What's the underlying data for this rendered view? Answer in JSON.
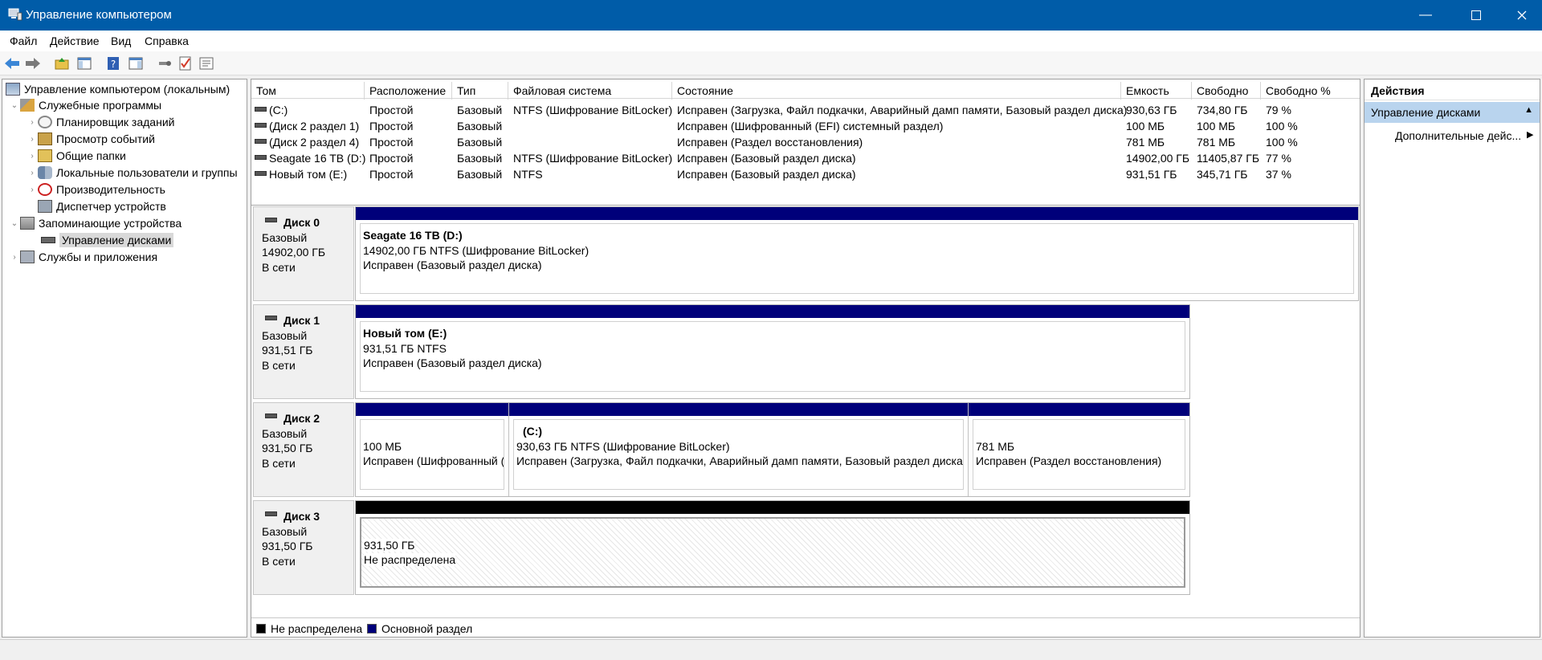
{
  "window": {
    "title": "Управление компьютером"
  },
  "menu": [
    "Файл",
    "Действие",
    "Вид",
    "Справка"
  ],
  "tree": {
    "root": "Управление компьютером (локальным)",
    "utilities": "Служебные программы",
    "scheduler": "Планировщик заданий",
    "events": "Просмотр событий",
    "shared": "Общие папки",
    "users": "Локальные пользователи и группы",
    "perf": "Производительность",
    "devmgr": "Диспетчер устройств",
    "storage": "Запоминающие устройства",
    "diskmgmt": "Управление дисками",
    "services": "Службы и приложения"
  },
  "volumes": {
    "headers": [
      "Том",
      "Расположение",
      "Тип",
      "Файловая система",
      "Состояние",
      "Емкость",
      "Свободно",
      "Свободно %"
    ],
    "rows": [
      [
        "(C:)",
        "Простой",
        "Базовый",
        "NTFS (Шифрование BitLocker)",
        "Исправен (Загрузка, Файл подкачки, Аварийный дамп памяти, Базовый раздел диска)",
        "930,63 ГБ",
        "734,80 ГБ",
        "79 %"
      ],
      [
        "(Диск 2 раздел 1)",
        "Простой",
        "Базовый",
        "",
        "Исправен (Шифрованный (EFI) системный раздел)",
        "100 МБ",
        "100 МБ",
        "100 %"
      ],
      [
        "(Диск 2 раздел 4)",
        "Простой",
        "Базовый",
        "",
        "Исправен (Раздел восстановления)",
        "781 МБ",
        "781 МБ",
        "100 %"
      ],
      [
        "Seagate 16 TB (D:)",
        "Простой",
        "Базовый",
        "NTFS (Шифрование BitLocker)",
        "Исправен (Базовый раздел диска)",
        "14902,00 ГБ",
        "11405,87 ГБ",
        "77 %"
      ],
      [
        "Новый том (E:)",
        "Простой",
        "Базовый",
        "NTFS",
        "Исправен (Базовый раздел диска)",
        "931,51 ГБ",
        "345,71 ГБ",
        "37 %"
      ]
    ]
  },
  "disks": [
    {
      "name": "Диск 0",
      "type": "Базовый",
      "size": "14902,00 ГБ",
      "state": "В сети",
      "parts": [
        {
          "title": "Seagate 16 TB  (D:)",
          "l1": "14902,00 ГБ NTFS (Шифрование BitLocker)",
          "l2": "Исправен (Базовый раздел диска)"
        }
      ]
    },
    {
      "name": "Диск 1",
      "type": "Базовый",
      "size": "931,51 ГБ",
      "state": "В сети",
      "parts": [
        {
          "title": "Новый том  (E:)",
          "l1": "931,51 ГБ NTFS",
          "l2": "Исправен (Базовый раздел диска)"
        }
      ]
    },
    {
      "name": "Диск 2",
      "type": "Базовый",
      "size": "931,50 ГБ",
      "state": "В сети",
      "parts": [
        {
          "title": "",
          "l1": "100 МБ",
          "l2": "Исправен (Шифрованный ("
        },
        {
          "title": "(C:)",
          "l1": "930,63 ГБ NTFS (Шифрование BitLocker)",
          "l2": "Исправен (Загрузка, Файл подкачки, Аварийный дамп памяти, Базовый раздел диска)"
        },
        {
          "title": "",
          "l1": "781 МБ",
          "l2": "Исправен (Раздел восстановления)"
        }
      ]
    },
    {
      "name": "Диск 3",
      "type": "Базовый",
      "size": "931,50 ГБ",
      "state": "В сети",
      "parts": [
        {
          "title": "",
          "l1": "931,50 ГБ",
          "l2": "Не распределена"
        }
      ]
    }
  ],
  "legend": {
    "unallocated": "Не распределена",
    "primary": "Основной раздел"
  },
  "actions": {
    "header": "Действия",
    "section": "Управление дисками",
    "more": "Дополнительные дейс..."
  },
  "colors": {
    "titlebar": "#005ca8",
    "primary_partition": "#00007a",
    "unallocated": "#000000",
    "selection": "#b9d4ee"
  }
}
